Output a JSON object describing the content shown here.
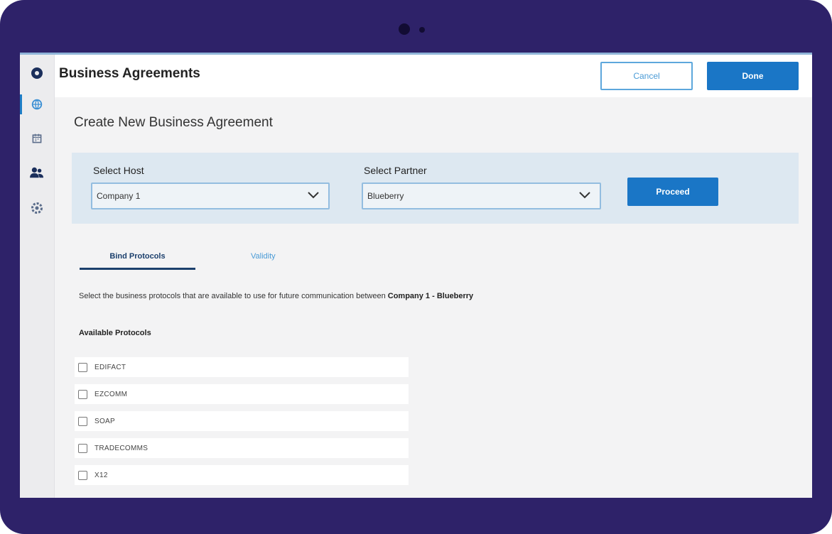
{
  "header": {
    "title": "Business Agreements",
    "cancel_label": "Cancel",
    "done_label": "Done"
  },
  "sidebar": {
    "items": [
      {
        "name": "dashboard",
        "icon": "circle-logo-icon"
      },
      {
        "name": "agreements",
        "icon": "globe-icon",
        "active": true
      },
      {
        "name": "calendar",
        "icon": "calendar-icon"
      },
      {
        "name": "partners",
        "icon": "users-icon"
      },
      {
        "name": "settings",
        "icon": "gear-icon"
      }
    ]
  },
  "main": {
    "section_title": "Create New Business Agreement",
    "host": {
      "label": "Select Host",
      "value": "Company 1"
    },
    "partner": {
      "label": "Select Partner",
      "value": "Blueberry"
    },
    "proceed_label": "Proceed",
    "tabs": [
      {
        "label": "Bind Protocols",
        "active": true
      },
      {
        "label": "Validity",
        "active": false
      }
    ],
    "instruction": "Select the business protocols that are available to use for future communication between ",
    "instruction_bold": "Company 1 - Blueberry",
    "available_title": "Available Protocols",
    "protocols": [
      "EDIFACT",
      "EZCOMM",
      "SOAP",
      "TRADECOMMS",
      "X12"
    ]
  },
  "colors": {
    "device_frame": "#2e2269",
    "primary": "#1a76c6",
    "band": "#dde8f1",
    "tab_active": "#1b3f6c"
  }
}
